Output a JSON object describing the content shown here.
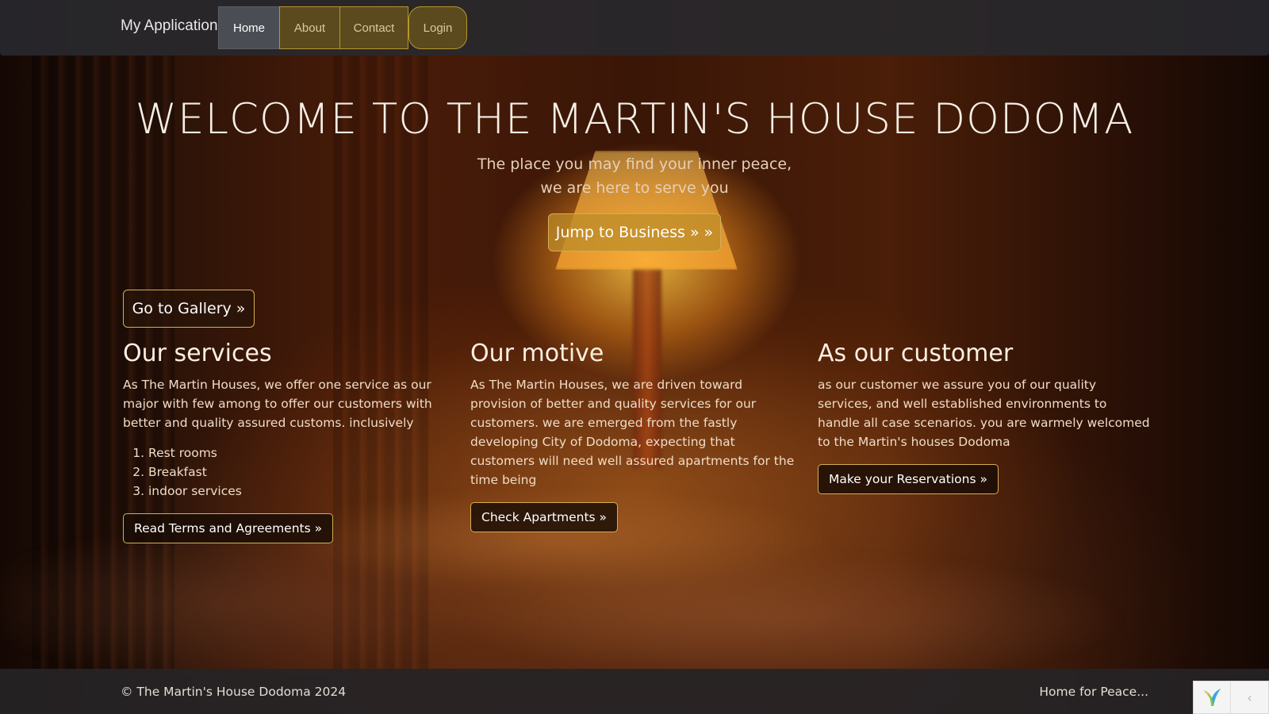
{
  "navbar": {
    "brand": "My Application",
    "items": [
      {
        "label": "Home",
        "active": true
      },
      {
        "label": "About"
      },
      {
        "label": "Contact"
      },
      {
        "label": "Login"
      }
    ]
  },
  "hero": {
    "title": "WELCOME TO THE MARTIN'S HOUSE DODOMA",
    "subtitle_line1": "The place you may find your inner peace,",
    "subtitle_line2": "we are here to serve you",
    "jump_button": "Jump to Business » »",
    "gallery_button": "Go to Gallery »"
  },
  "columns": {
    "services": {
      "heading": "Our services",
      "text": "As The Martin Houses, we offer one service as our major with few among to offer our customers with better and quality assured customs. inclusively",
      "list": [
        "Rest rooms",
        "Breakfast",
        "indoor services"
      ],
      "button": "Read Terms and Agreements »"
    },
    "motive": {
      "heading": "Our motive",
      "text": "As The Martin Houses, we are driven toward provision of better and quality services for our customers. we are emerged from the fastly developing City of Dodoma, expecting that customers will need well assured apartments for the time being",
      "button": "Check Apartments »"
    },
    "customer": {
      "heading": "As our customer",
      "text": "as our customer we assure you of our quality services, and well established environments to handle all case scenarios. you are warmely welcomed to the Martin's houses Dodoma",
      "button": "Make your Reservations »"
    }
  },
  "footer": {
    "copyright": "© The Martin's House Dodoma 2024",
    "tagline": "Home for Peace..."
  },
  "debug_toolbar": {
    "logo_icon": "yii-logo-icon",
    "collapse_icon": "chevron-left-icon"
  },
  "colors": {
    "accent_border": "#d4ae55",
    "navbar_bg": "#28282c",
    "footer_bg": "#262426"
  }
}
